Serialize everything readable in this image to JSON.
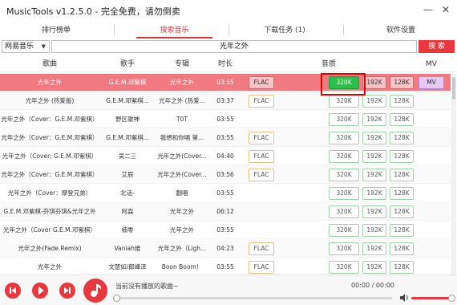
{
  "app": {
    "title": "MusicTools  v1.2.5.0 - 完全免费，请勿倒卖",
    "minimize_icon": "minimize-icon",
    "close_icon": "close-icon"
  },
  "tabs": [
    {
      "label": "排行榜单",
      "active": false
    },
    {
      "label": "搜索音乐",
      "active": true
    },
    {
      "label": "下载任务 (1)",
      "active": false
    },
    {
      "label": "软件设置",
      "active": false
    }
  ],
  "search": {
    "source": "网易音乐",
    "query": "光年之外",
    "button_label": "搜 索"
  },
  "table": {
    "headers": {
      "song": "歌曲",
      "artist": "歌手",
      "album": "专辑",
      "duration": "时长",
      "quality": "音质",
      "mv": "MV"
    },
    "rows": [
      {
        "song": "光年之外",
        "artist": "G.E.M.邓紫棋",
        "album": "光年之外",
        "duration": "03:55",
        "flac": "FLAC",
        "q320": "320K",
        "q192": "192K",
        "q128": "128K",
        "mv": "MV"
      },
      {
        "song": "光年之外 (热爱版)",
        "artist": "G.E.M.邓紫棋...",
        "album": "光年之外 (热爱...",
        "duration": "03:37",
        "flac": "FLAC",
        "q320": "320K",
        "q192": "192K",
        "q128": "128K",
        "mv": ""
      },
      {
        "song": "光年之外（Cover：G.E.M.邓紫棋）",
        "artist": "野区歌神",
        "album": "T0T",
        "duration": "03:55",
        "flac": "",
        "q320": "320K",
        "q192": "192K",
        "q128": "128K",
        "mv": ""
      },
      {
        "song": "光年之外（Cover：G.E.M.邓紫棋）",
        "artist": "G.E.M.邓紫棋...",
        "album": "我想和你唱 第...",
        "duration": "03:55",
        "flac": "FLAC",
        "q320": "320K",
        "q192": "192K",
        "q128": "128K",
        "mv": ""
      },
      {
        "song": "光年之外（Cover; G.E.M.邓紫棋）",
        "artist": "吴二三",
        "album": "光年之外(Cover...",
        "duration": "04:40",
        "flac": "FLAC",
        "q320": "320K",
        "q192": "192K",
        "q128": "128K",
        "mv": ""
      },
      {
        "song": "光年之外（Cover：G.E.M.邓紫棋）",
        "artist": "艾辰",
        "album": "光年之外(Cover...",
        "duration": "03:56",
        "flac": "FLAC",
        "q320": "320K",
        "q192": "192K",
        "q128": "128K",
        "mv": ""
      },
      {
        "song": "光年之外（Cover：摩登兄弟）",
        "artist": "北话-",
        "album": "翻唱",
        "duration": "03:55",
        "flac": "",
        "q320": "320K",
        "q192": "192K",
        "q128": "128K",
        "mv": ""
      },
      {
        "song": "G.E.M.邓紫棋-芬琪芬琪&光年之外",
        "artist": "阿森",
        "album": "光年之外",
        "duration": "06:12",
        "flac": "",
        "q320": "320K",
        "q192": "192K",
        "q128": "128K",
        "mv": ""
      },
      {
        "song": "光年之外（Cover G.E.M.邓紫棋）",
        "artist": "楠零",
        "album": "光年之外",
        "duration": "03:55",
        "flac": "",
        "q320": "320K",
        "q192": "192K",
        "q128": "128K",
        "mv": ""
      },
      {
        "song": "光年之外(Fade.Remix)",
        "artist": "Vaniah维",
        "album": "光年之外（Ligh...",
        "duration": "04:23",
        "flac": "FLAC",
        "q320": "320K",
        "q192": "192K",
        "q128": "128K",
        "mv": ""
      },
      {
        "song": "光年之外",
        "artist": "文慧如/郎峰泽",
        "album": "Boon Boom！",
        "duration": "03:55",
        "flac": "FLAC",
        "q320": "320K",
        "q192": "192K",
        "q128": "128K",
        "mv": ""
      }
    ]
  },
  "player": {
    "status": "当前没有播放的歌曲~",
    "time": "00:00 / 00:00",
    "icons": [
      "previous-icon",
      "play-icon",
      "next-icon",
      "music-note-icon",
      "volume-icon"
    ],
    "progress": 0,
    "volume": 1
  },
  "colors": {
    "accent": "#e8383d",
    "selected_row": "#f07a80",
    "quality_selected": "#29c04a",
    "highlight_box": "#e00000"
  }
}
